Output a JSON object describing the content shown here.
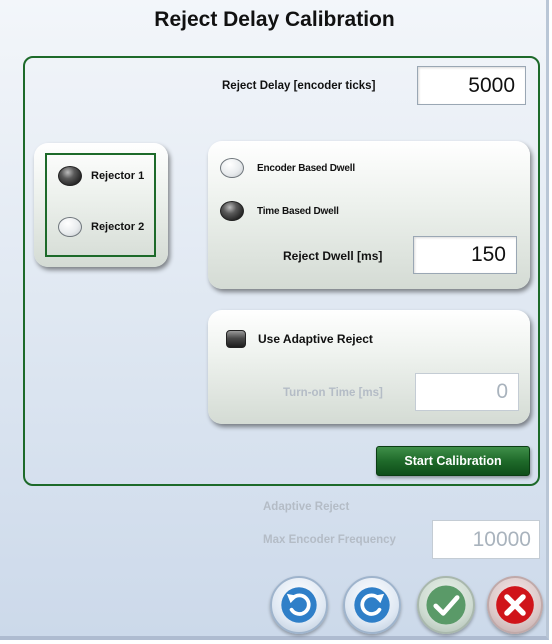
{
  "dialog": {
    "title": "Reject Delay Calibration"
  },
  "reject_delay": {
    "label": "Reject Delay [encoder ticks]",
    "value": "5000"
  },
  "rejector_group": {
    "options": [
      {
        "label": "Rejector 1",
        "selected": true
      },
      {
        "label": "Rejector 2",
        "selected": false
      }
    ]
  },
  "dwell_group": {
    "options": [
      {
        "label": "Encoder Based Dwell",
        "selected": false
      },
      {
        "label": "Time Based Dwell",
        "selected": true
      }
    ],
    "dwell_label": "Reject Dwell [ms]",
    "dwell_value": "150"
  },
  "adaptive_group": {
    "checkbox_label": "Use Adaptive Reject",
    "checked": false,
    "turn_on_label": "Turn-on Time [ms]",
    "turn_on_value": "0"
  },
  "start_button": {
    "label": "Start Calibration"
  },
  "adaptive_info": {
    "heading": "Adaptive Reject",
    "freq_label": "Max Encoder Frequency",
    "freq_value": "10000"
  },
  "actions": {
    "icons": [
      "undo-icon",
      "redo-icon",
      "check-icon",
      "close-icon"
    ],
    "colors": {
      "undo_redo": "#2f7fc8",
      "confirm": "#5a9a68",
      "cancel": "#d0141a"
    }
  }
}
